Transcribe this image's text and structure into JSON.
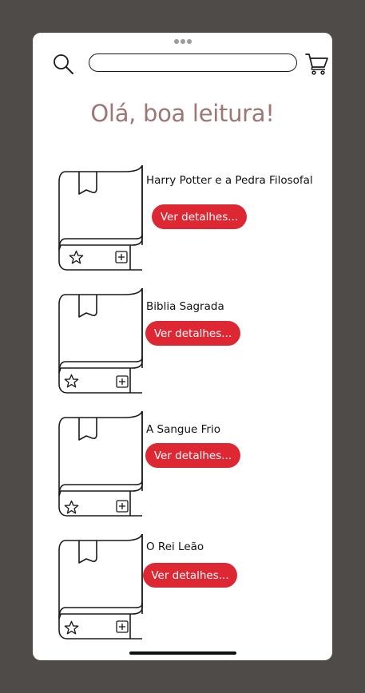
{
  "search": {
    "placeholder": ""
  },
  "greeting": "Olá, boa leitura!",
  "books": [
    {
      "title": "Harry Potter e a Pedra Filosofal",
      "button_label": "Ver detalhes..."
    },
    {
      "title": "Biblia Sagrada",
      "button_label": "Ver detalhes..."
    },
    {
      "title": "A Sangue Frio",
      "button_label": "Ver detalhes..."
    },
    {
      "title": "O Rei Leão",
      "button_label": "Ver detalhes..."
    }
  ],
  "icons": {
    "search": "search-icon",
    "cart": "cart-icon",
    "book": "book-icon",
    "bookmark": "bookmark-icon",
    "favorite": "star-icon",
    "add": "plus-square-icon"
  },
  "colors": {
    "background": "#4e4b49",
    "screen": "#ffffff",
    "greeting": "#9e7775",
    "button": "#dd2834",
    "button_text": "#ffffff"
  }
}
